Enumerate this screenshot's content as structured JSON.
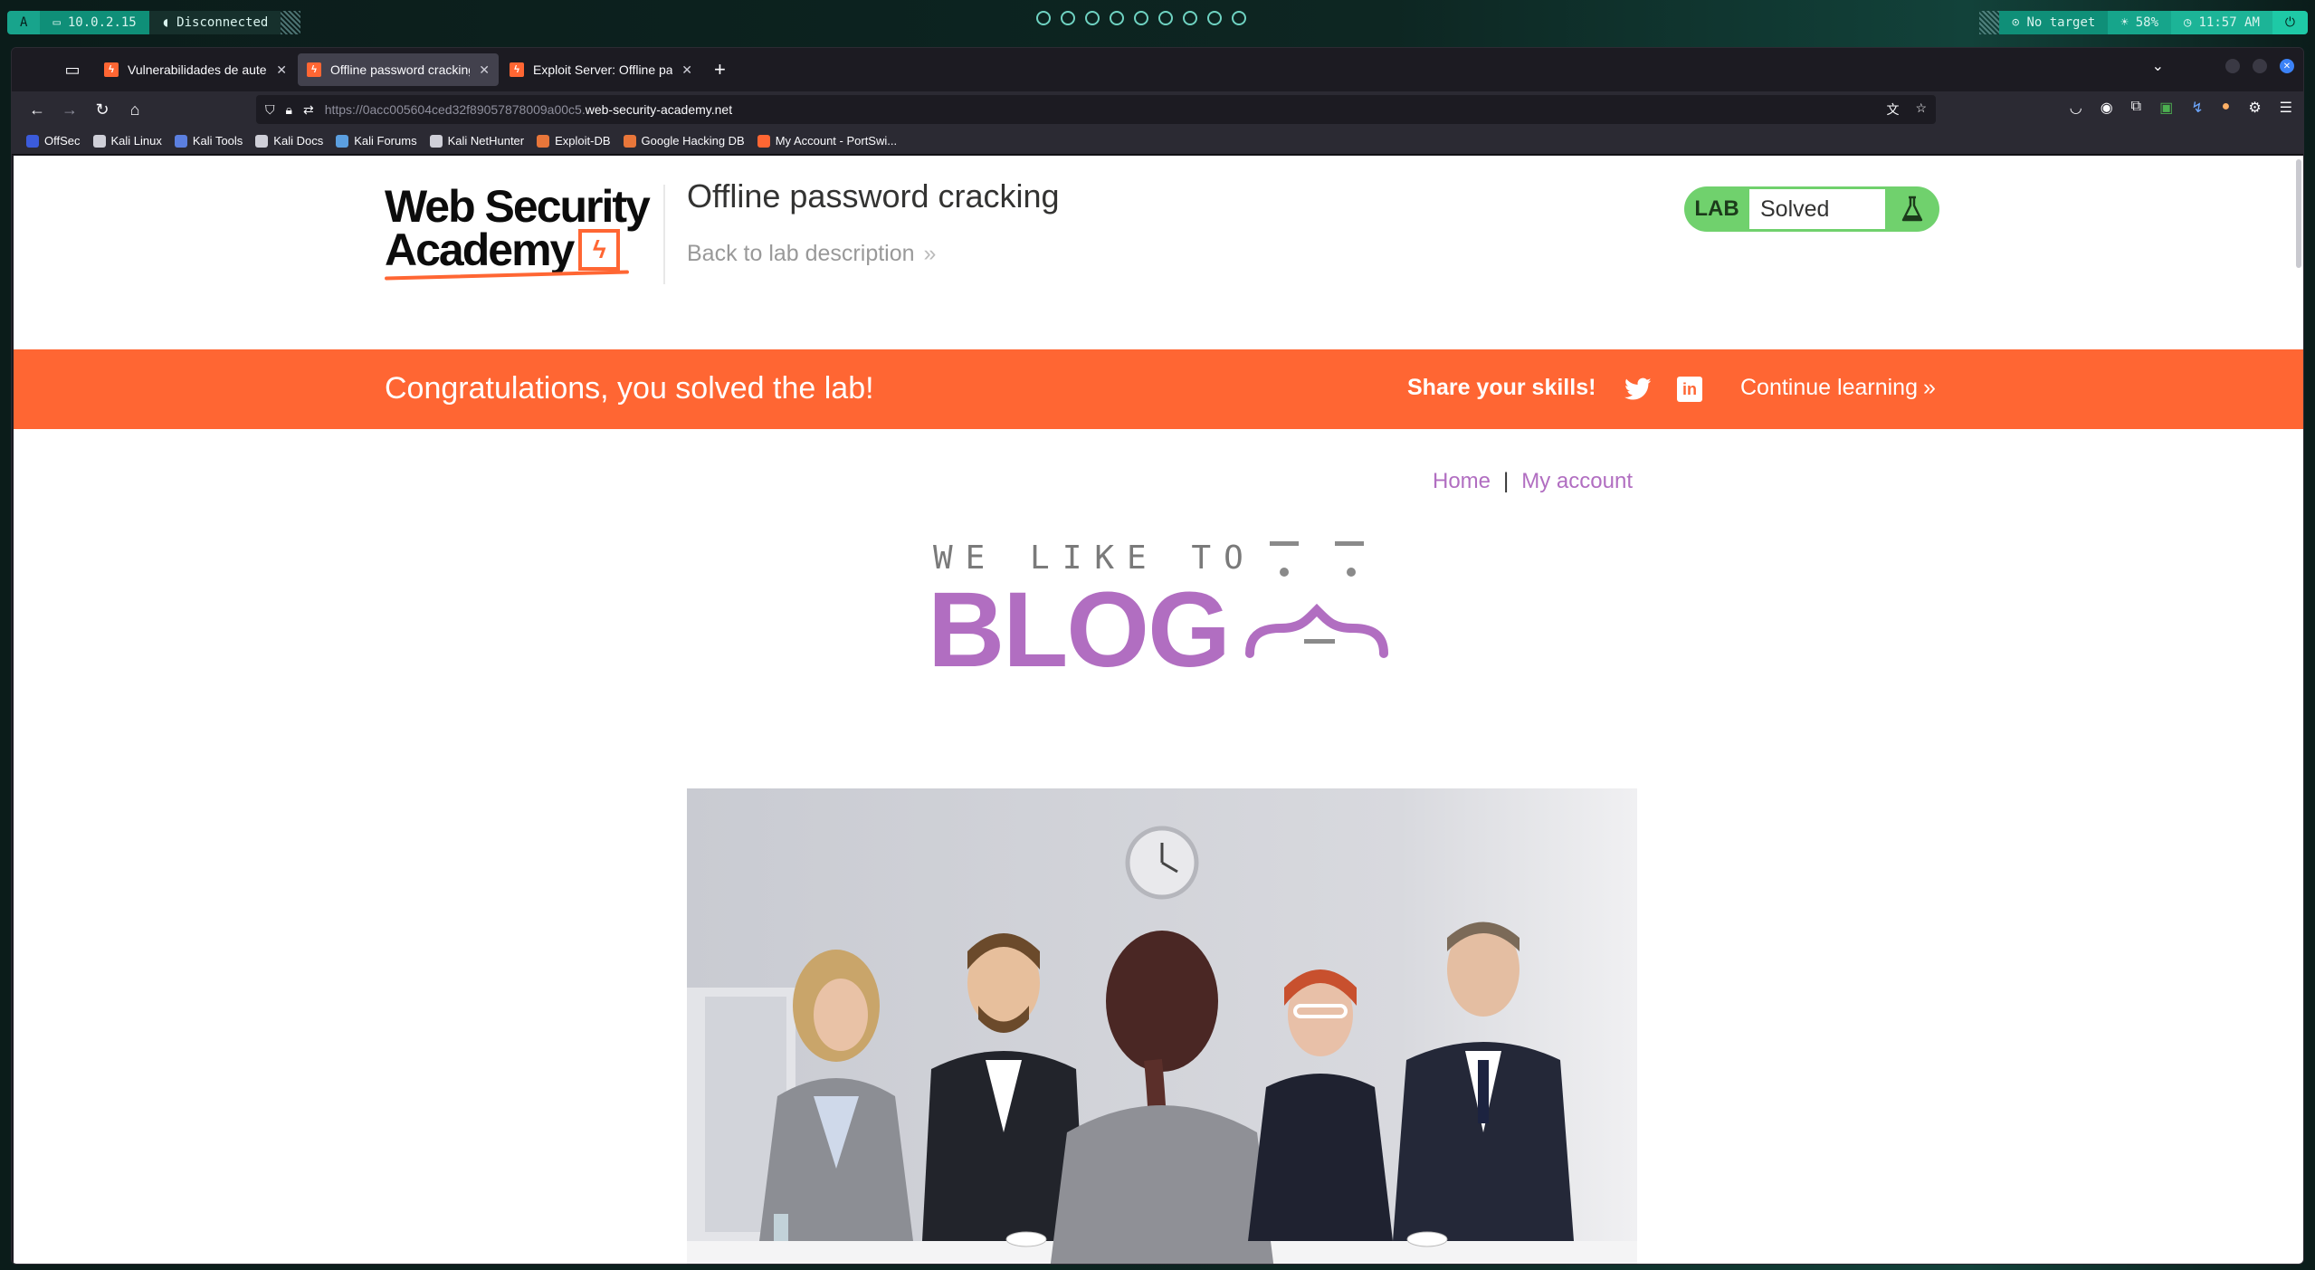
{
  "os_bar": {
    "launcher": "A",
    "ip": "10.0.2.15",
    "vpn_status": "Disconnected",
    "workspaces": [
      "1",
      "2",
      "3",
      "4",
      "5",
      "6",
      "7",
      "8",
      "9"
    ],
    "target": "No target",
    "brightness": "58%",
    "clock": "11:57 AM"
  },
  "browser": {
    "tabs": [
      {
        "title": "Vulnerabilidades de autenti",
        "active": false
      },
      {
        "title": "Offline password cracking",
        "active": true
      },
      {
        "title": "Exploit Server: Offline pass",
        "active": false
      }
    ],
    "url_prefix": "https://0acc005604ced32f89057878009a00c5.",
    "url_domain": "web-security-academy.net",
    "bookmarks": [
      {
        "label": "OffSec",
        "color": "#3b5bdb"
      },
      {
        "label": "Kali Linux",
        "color": "#cfcfd8"
      },
      {
        "label": "Kali Tools",
        "color": "#5b7fe0"
      },
      {
        "label": "Kali Docs",
        "color": "#cfcfd8"
      },
      {
        "label": "Kali Forums",
        "color": "#5b9fe0"
      },
      {
        "label": "Kali NetHunter",
        "color": "#cfcfd8"
      },
      {
        "label": "Exploit-DB",
        "color": "#e8763a"
      },
      {
        "label": "Google Hacking DB",
        "color": "#e8763a"
      },
      {
        "label": "My Account - PortSwi...",
        "color": "#ff6633"
      }
    ]
  },
  "academy": {
    "logo_line1": "Web Security",
    "logo_line2": "Academy",
    "lab_title": "Offline password cracking",
    "back_link": "Back to lab description",
    "lab_badge": "LAB",
    "lab_state": "Solved"
  },
  "congrats": {
    "message": "Congratulations, you solved the lab!",
    "share_label": "Share your skills!",
    "continue_label": "Continue learning"
  },
  "blog": {
    "nav_home": "Home",
    "nav_separator": "|",
    "nav_account": "My account",
    "logo_top": "WE LIKE TO",
    "logo_word": "BLOG"
  },
  "colors": {
    "accent_orange": "#ff6633",
    "lab_green": "#70d16d",
    "blog_purple": "#b16ec1"
  }
}
